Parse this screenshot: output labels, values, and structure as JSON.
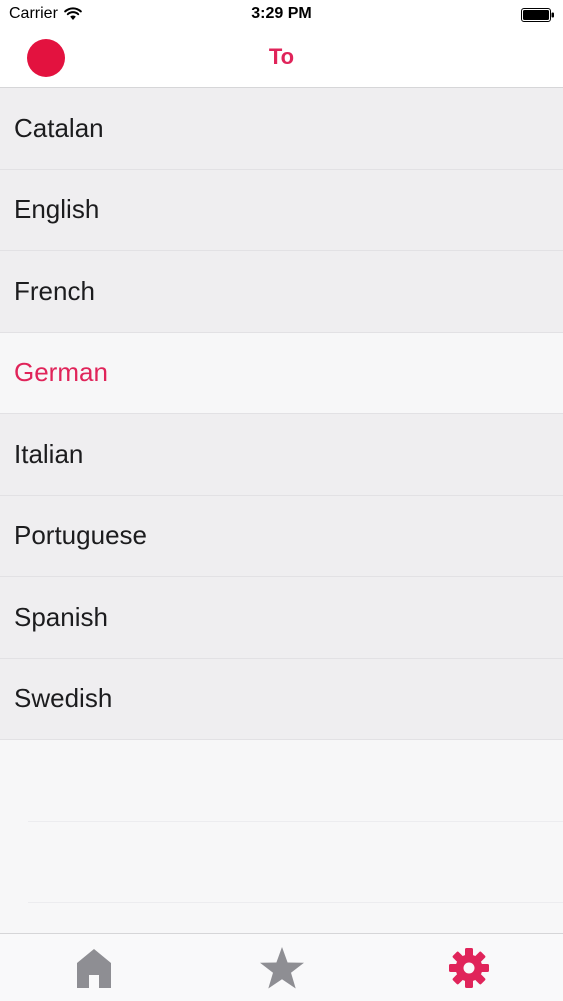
{
  "status_bar": {
    "carrier": "Carrier",
    "time": "3:29 PM"
  },
  "nav": {
    "title": "To",
    "record_button_color": "#e3123f"
  },
  "languages": [
    {
      "label": "Catalan",
      "selected": false
    },
    {
      "label": "English",
      "selected": false
    },
    {
      "label": "French",
      "selected": false
    },
    {
      "label": "German",
      "selected": true
    },
    {
      "label": "Italian",
      "selected": false
    },
    {
      "label": "Portuguese",
      "selected": false
    },
    {
      "label": "Spanish",
      "selected": false
    },
    {
      "label": "Swedish",
      "selected": false
    }
  ],
  "tab_bar": {
    "items": [
      {
        "icon": "home-icon",
        "active": false
      },
      {
        "icon": "star-icon",
        "active": false
      },
      {
        "icon": "gear-icon",
        "active": true
      }
    ]
  },
  "colors": {
    "accent": "#e0245a",
    "inactive_icon": "#8e8e93",
    "row_bg": "#efeef0",
    "selected_row_bg": "#f7f7f8"
  }
}
